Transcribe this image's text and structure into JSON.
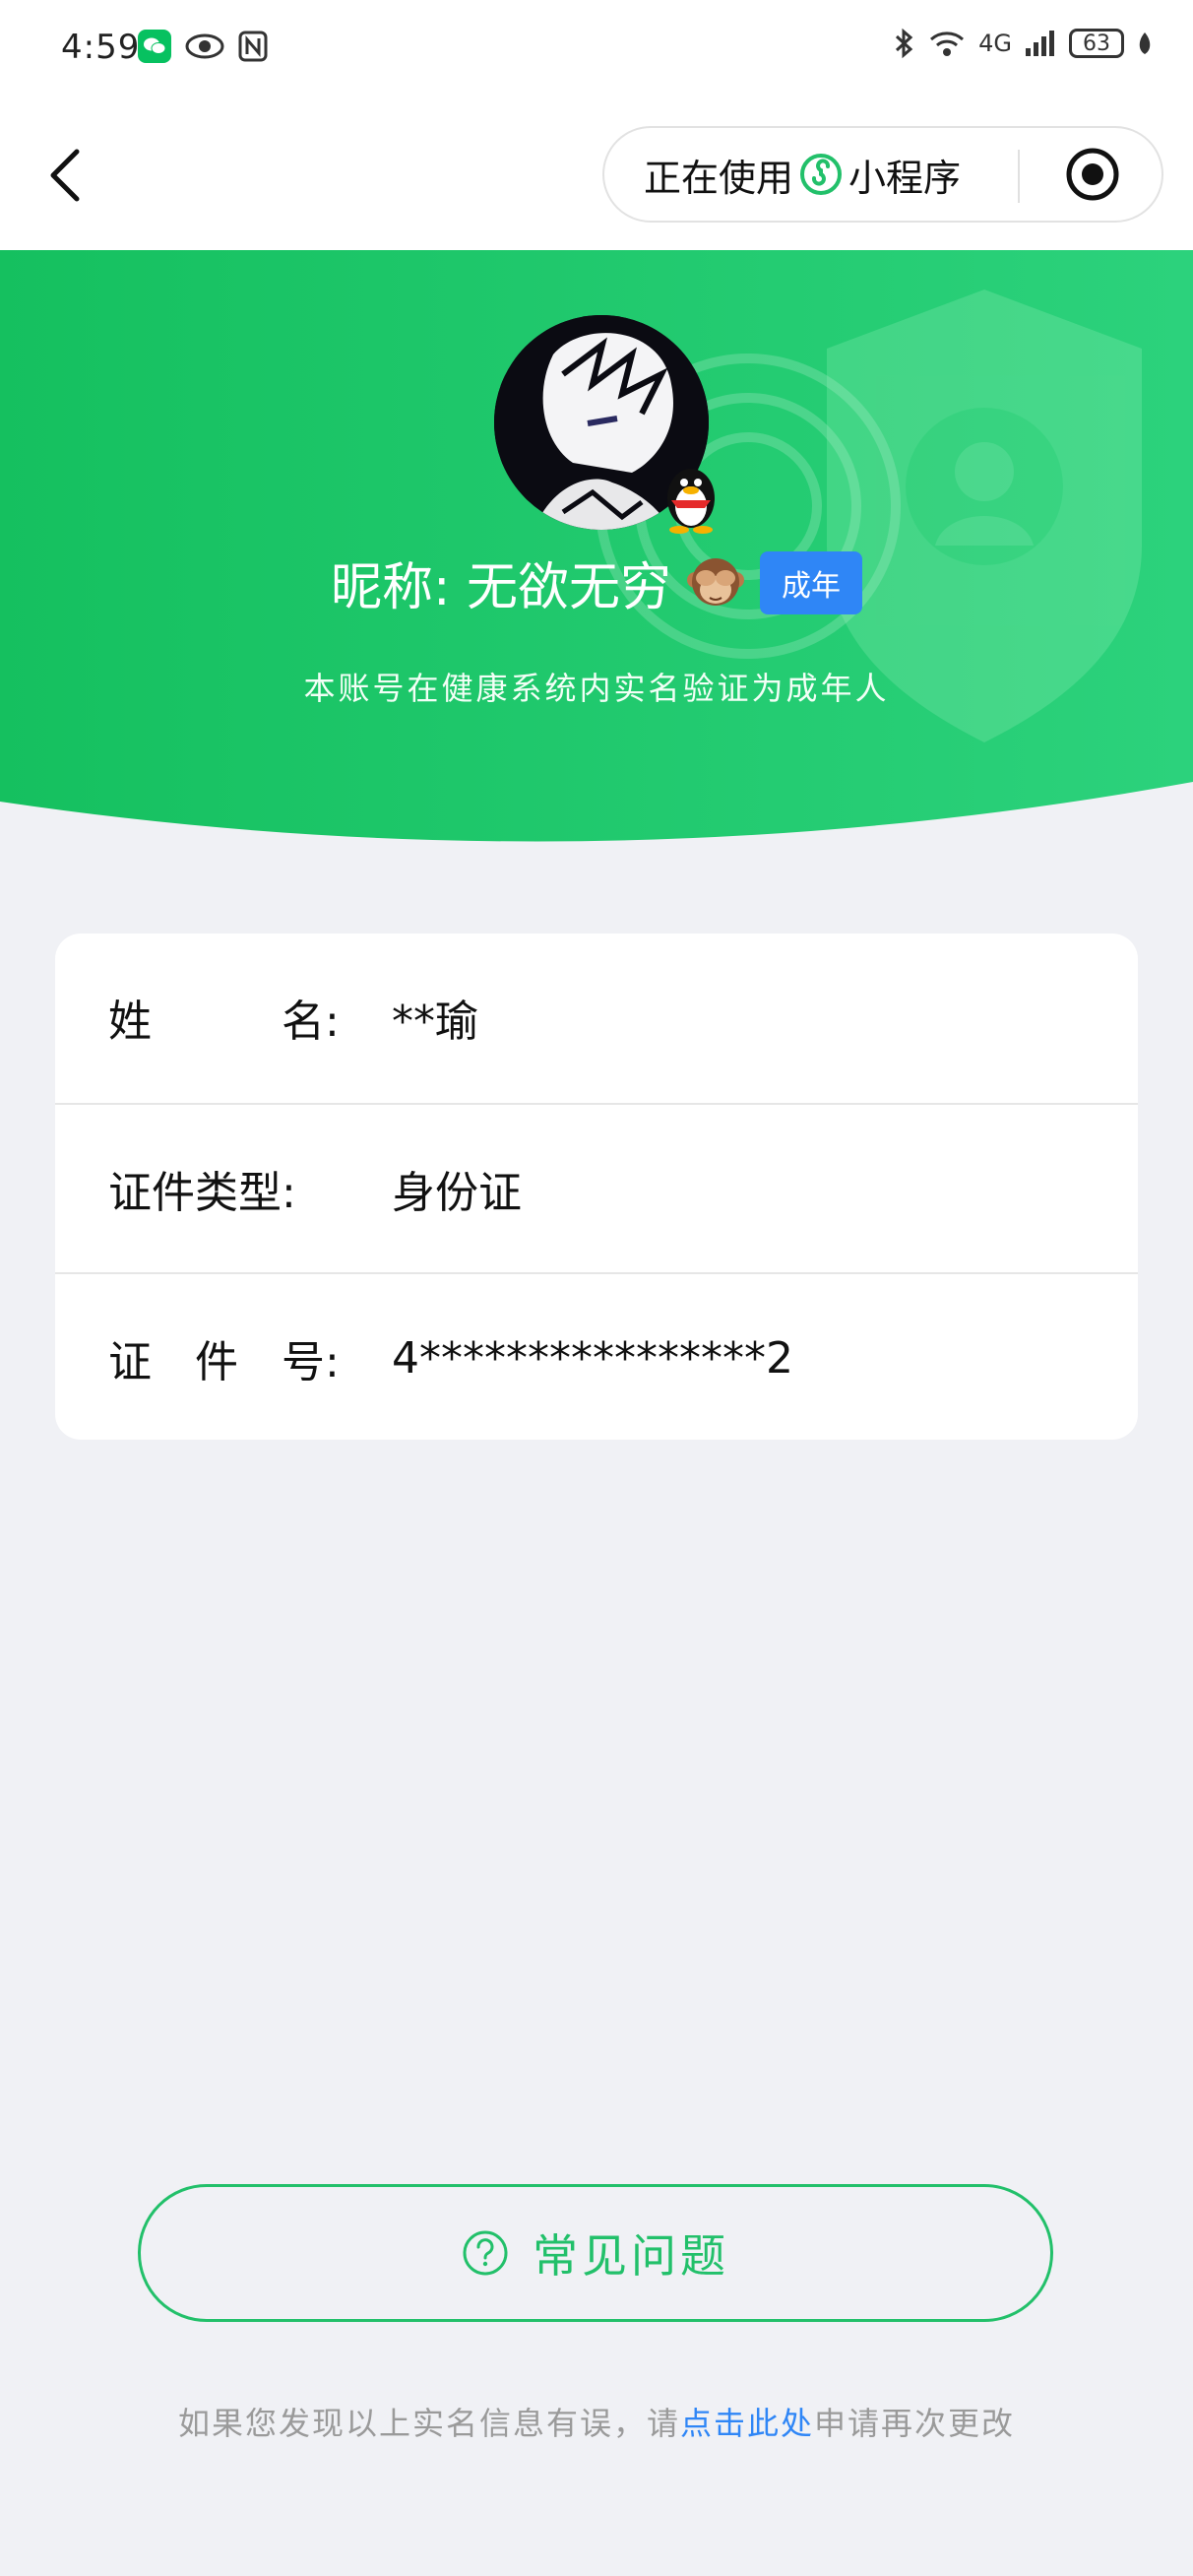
{
  "status_bar": {
    "time": "4:59",
    "battery": "63",
    "network": "4G"
  },
  "navbar": {
    "capsule_prefix": "正在使用",
    "capsule_suffix": "小程序"
  },
  "profile": {
    "nickname": "昵称: 无欲无穷",
    "badge": "成年",
    "subtitle": "本账号在健康系统内实名验证为成年人"
  },
  "info": {
    "rows": [
      {
        "label": "姓　　　名:",
        "value": "**瑜"
      },
      {
        "label": "证件类型:",
        "value": "身份证"
      },
      {
        "label": "证　件　号:",
        "value": "4****************2"
      }
    ]
  },
  "faq": {
    "label": "常见问题"
  },
  "footer": {
    "prefix": "如果您发现以上实名信息有误，请",
    "link": "点击此处",
    "suffix": "申请再次更改"
  },
  "colors": {
    "green": "#22c06a",
    "blue": "#2f86f6"
  }
}
